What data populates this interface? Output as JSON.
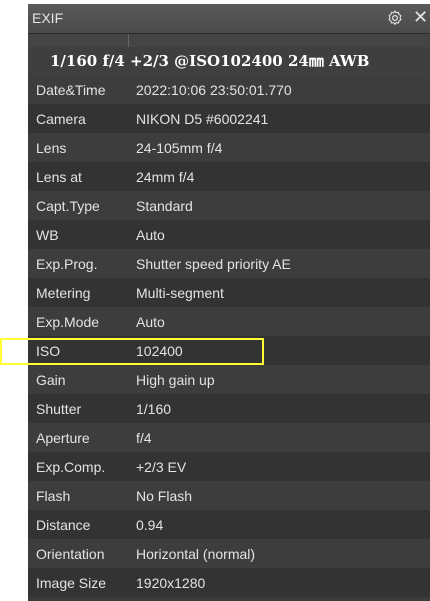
{
  "panel": {
    "title": "EXIF",
    "summary": "1/160 f/4 +2/3 @ISO102400 24㎜ AWB"
  },
  "rows": [
    {
      "label": "Date&Time",
      "value": "2022:10:06 23:50:01.770"
    },
    {
      "label": "Camera",
      "value": "NIKON D5 #6002241"
    },
    {
      "label": "Lens",
      "value": "24-105mm f/4"
    },
    {
      "label": "Lens at",
      "value": "24mm f/4"
    },
    {
      "label": "Capt.Type",
      "value": "Standard"
    },
    {
      "label": "WB",
      "value": "Auto"
    },
    {
      "label": "Exp.Prog.",
      "value": "Shutter speed priority AE"
    },
    {
      "label": "Metering",
      "value": "Multi-segment"
    },
    {
      "label": "Exp.Mode",
      "value": "Auto"
    },
    {
      "label": "ISO",
      "value": "102400"
    },
    {
      "label": "Gain",
      "value": "High gain up"
    },
    {
      "label": "Shutter",
      "value": "1/160"
    },
    {
      "label": "Aperture",
      "value": "f/4"
    },
    {
      "label": "Exp.Comp.",
      "value": "+2/3 EV"
    },
    {
      "label": "Flash",
      "value": "No Flash"
    },
    {
      "label": "Distance",
      "value": "0.94"
    },
    {
      "label": "Orientation",
      "value": "Horizontal (normal)"
    },
    {
      "label": "Image Size",
      "value": "1920x1280"
    }
  ],
  "highlight_color": "#ffff33"
}
